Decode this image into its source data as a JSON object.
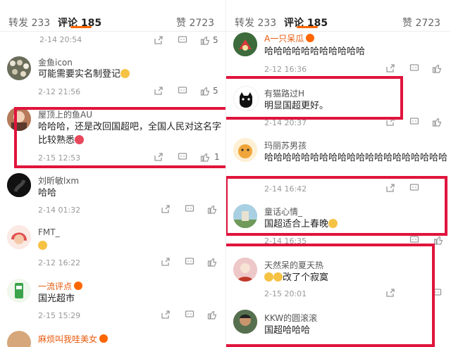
{
  "left": {
    "tabs": {
      "repost": "转发 233",
      "comments": "评论 185",
      "likes": "赞 2723"
    },
    "time_top": "2-14 20:54",
    "comments": [
      {
        "user": "金鱼icon",
        "text": "可能需要实名制登记",
        "time": "2-12 21:56",
        "likes": "5"
      },
      {
        "user": "屋顶上的鱼AU",
        "text": "哈哈哈，还是改回国超吧，全国人民对这名字比较熟悉",
        "time": "2-15 12:53",
        "likes": "1"
      },
      {
        "user": "刘昕敏lxm",
        "text": "哈哈",
        "time": "2-14 01:32"
      },
      {
        "user": "FMT_",
        "text": "",
        "time": "2-12 16:22"
      },
      {
        "user": "一流评点",
        "text": "国光超市",
        "time": "2-15 15:29"
      },
      {
        "user": "麻烦叫我哇美女",
        "text": ""
      }
    ]
  },
  "right": {
    "tabs": {
      "repost": "转发 233",
      "comments": "评论 185",
      "likes": "赞 2723"
    },
    "comments": [
      {
        "user": "A一只呆瓜",
        "text": "哈哈哈哈哈哈哈哈哈哈哈",
        "time": "2-12 16:36"
      },
      {
        "user": "有猫路过H",
        "text": "明显国超更好。",
        "time": "2-14 20:37"
      },
      {
        "user": "玛丽苏男孩",
        "text": "哈哈哈哈哈哈哈哈哈哈哈哈哈哈哈哈哈哈哈哈",
        "time": "2-14 16:42"
      },
      {
        "user": "童话心情_",
        "text": "国超适合上春晚",
        "time": "2-14 16:35"
      },
      {
        "user": "天然呆的夏天热",
        "text": "改了个寂寞",
        "time": "2-15 20:01"
      },
      {
        "user": "KKW的圆滚滚",
        "text": "国超哈哈哈"
      }
    ]
  },
  "colors": {
    "highlight": "#e0143c",
    "accent": "#ff6600",
    "vip_name": "#e8590c"
  },
  "icons": [
    "share-icon",
    "comment-icon",
    "like-icon",
    "vip-badge-icon",
    "emoji-icon"
  ]
}
